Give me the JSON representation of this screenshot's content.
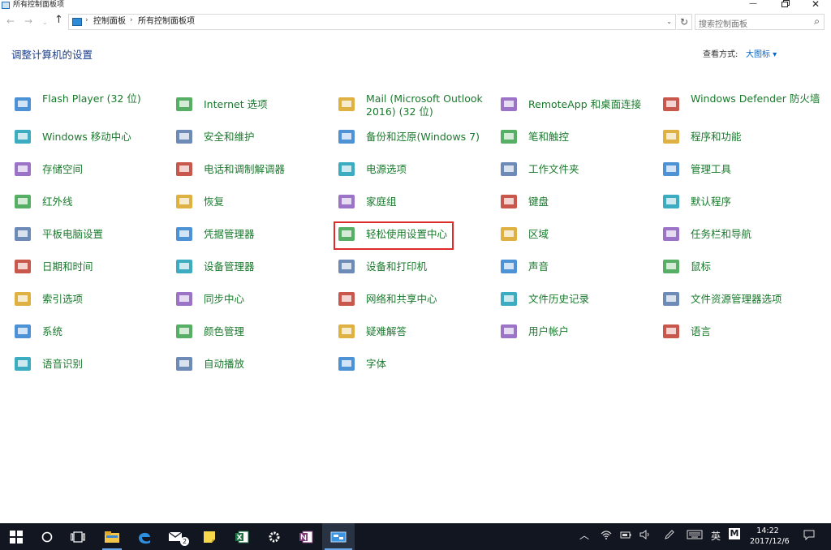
{
  "window": {
    "title": "所有控制面板项",
    "minimize_glyph": "—",
    "close_glyph": "✕"
  },
  "nav": {
    "back_glyph": "←",
    "forward_glyph": "→",
    "recent_glyph": "⌄",
    "up_glyph": "↑"
  },
  "address": {
    "crumbs": [
      "控制面板",
      "所有控制面板项"
    ],
    "separator": "›",
    "dropdown_glyph": "⌄",
    "refresh_glyph": "↻"
  },
  "search": {
    "placeholder": "搜索控制面板",
    "glyph": "⌕"
  },
  "page": {
    "heading": "调整计算机的设置",
    "view_by_label": "查看方式:",
    "view_by_value": "大图标 ▾"
  },
  "items": [
    {
      "label": "Flash Player (32 位)",
      "icon": "flash-player-icon"
    },
    {
      "label": "Internet 选项",
      "icon": "internet-options-icon"
    },
    {
      "label": "Mail (Microsoft Outlook 2016) (32 位)",
      "icon": "mail-icon"
    },
    {
      "label": "RemoteApp 和桌面连接",
      "icon": "remoteapp-icon"
    },
    {
      "label": "Windows Defender 防火墙",
      "icon": "firewall-icon"
    },
    {
      "label": "Windows 移动中心",
      "icon": "mobility-center-icon"
    },
    {
      "label": "安全和维护",
      "icon": "security-flag-icon"
    },
    {
      "label": "备份和还原(Windows 7)",
      "icon": "backup-icon"
    },
    {
      "label": "笔和触控",
      "icon": "pen-icon"
    },
    {
      "label": "程序和功能",
      "icon": "programs-icon"
    },
    {
      "label": "存储空间",
      "icon": "storage-icon"
    },
    {
      "label": "电话和调制解调器",
      "icon": "phone-modem-icon"
    },
    {
      "label": "电源选项",
      "icon": "power-icon"
    },
    {
      "label": "工作文件夹",
      "icon": "work-folders-icon"
    },
    {
      "label": "管理工具",
      "icon": "admin-tools-icon"
    },
    {
      "label": "红外线",
      "icon": "infrared-icon"
    },
    {
      "label": "恢复",
      "icon": "recovery-icon"
    },
    {
      "label": "家庭组",
      "icon": "homegroup-icon"
    },
    {
      "label": "键盘",
      "icon": "keyboard-icon"
    },
    {
      "label": "默认程序",
      "icon": "default-programs-icon"
    },
    {
      "label": "平板电脑设置",
      "icon": "tablet-icon"
    },
    {
      "label": "凭据管理器",
      "icon": "credential-icon"
    },
    {
      "label": "轻松使用设置中心",
      "icon": "ease-of-access-icon"
    },
    {
      "label": "区域",
      "icon": "region-icon"
    },
    {
      "label": "任务栏和导航",
      "icon": "taskbar-icon"
    },
    {
      "label": "日期和时间",
      "icon": "date-time-icon"
    },
    {
      "label": "设备管理器",
      "icon": "device-manager-icon"
    },
    {
      "label": "设备和打印机",
      "icon": "printer-icon"
    },
    {
      "label": "声音",
      "icon": "sound-icon"
    },
    {
      "label": "鼠标",
      "icon": "mouse-icon"
    },
    {
      "label": "索引选项",
      "icon": "indexing-icon"
    },
    {
      "label": "同步中心",
      "icon": "sync-icon"
    },
    {
      "label": "网络和共享中心",
      "icon": "network-icon"
    },
    {
      "label": "文件历史记录",
      "icon": "file-history-icon"
    },
    {
      "label": "文件资源管理器选项",
      "icon": "folder-options-icon"
    },
    {
      "label": "系统",
      "icon": "system-icon"
    },
    {
      "label": "颜色管理",
      "icon": "color-management-icon"
    },
    {
      "label": "疑难解答",
      "icon": "troubleshooting-icon"
    },
    {
      "label": "用户帐户",
      "icon": "user-accounts-icon"
    },
    {
      "label": "语言",
      "icon": "language-icon"
    },
    {
      "label": "语音识别",
      "icon": "speech-icon"
    },
    {
      "label": "自动播放",
      "icon": "autoplay-icon"
    },
    {
      "label": "字体",
      "icon": "fonts-icon"
    }
  ],
  "highlighted_item": "轻松使用设置中心",
  "taskbar": {
    "mail_badge": "2",
    "tray_chevron": "︿",
    "ime_label": "英",
    "ime_mode": "M",
    "time": "14:22",
    "date": "2017/12/6"
  },
  "colors": {
    "link_green": "#197a2c",
    "heading_blue": "#1a3e8c",
    "highlight_red": "#e02b2b",
    "taskbar_bg": "#121620"
  }
}
